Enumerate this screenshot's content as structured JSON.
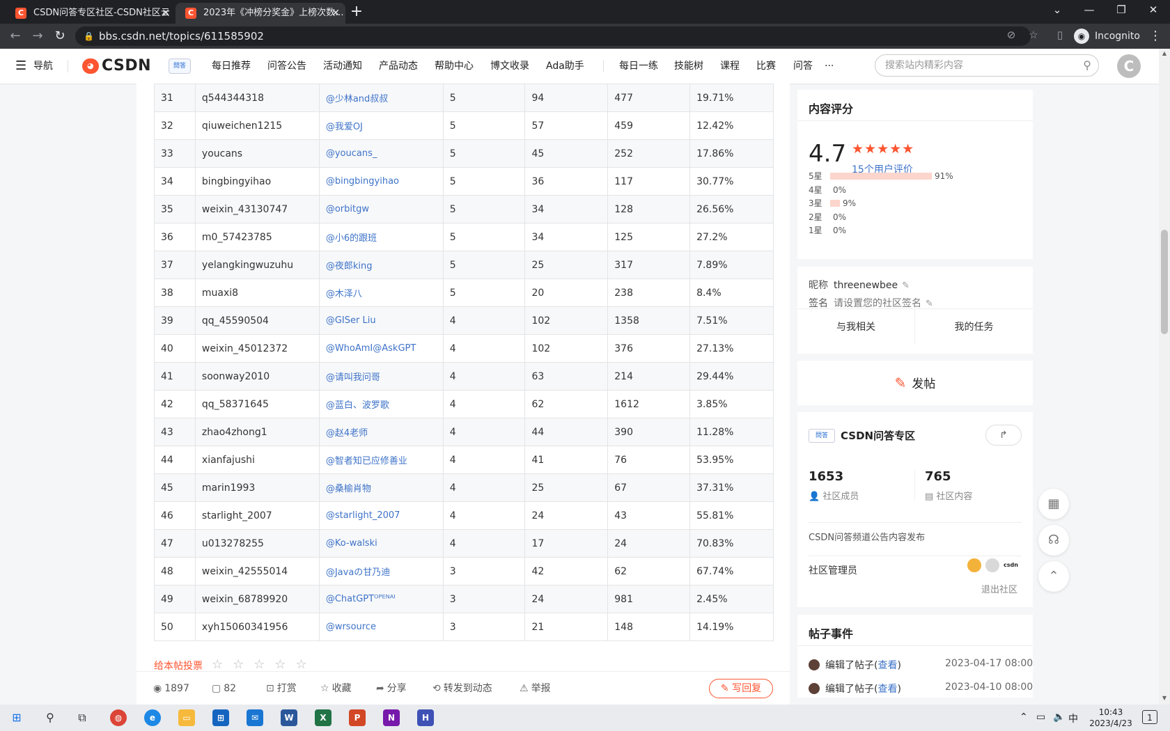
{
  "browser": {
    "tabs": [
      {
        "title": "CSDN问答专区社区-CSDN社区云",
        "active": false
      },
      {
        "title": "2023年《冲榜分奖金》上榜次数...",
        "active": true
      }
    ],
    "url": "bbs.csdn.net/topics/611585902",
    "incognito_label": "Incognito"
  },
  "site": {
    "nav_label": "导航",
    "logo_text": "CSDN",
    "section_badge": "問答",
    "nav_items": [
      "每日推荐",
      "问答公告",
      "活动通知",
      "产品动态",
      "帮助中心",
      "博文收录",
      "Ada助手",
      "每日一练",
      "技能树",
      "课程",
      "比赛",
      "问答",
      "···"
    ],
    "search_placeholder": "搜索站内精彩内容"
  },
  "table": {
    "rows": [
      [
        "31",
        "q544344318",
        "@少林and叔叔",
        "5",
        "94",
        "477",
        "19.71%"
      ],
      [
        "32",
        "qiuweichen1215",
        "@我爱OJ",
        "5",
        "57",
        "459",
        "12.42%"
      ],
      [
        "33",
        "youcans",
        "@youcans_",
        "5",
        "45",
        "252",
        "17.86%"
      ],
      [
        "34",
        "bingbingyihao",
        "@bingbingyihao",
        "5",
        "36",
        "117",
        "30.77%"
      ],
      [
        "35",
        "weixin_43130747",
        "@orbitgw",
        "5",
        "34",
        "128",
        "26.56%"
      ],
      [
        "36",
        "m0_57423785",
        "@小6的跟班",
        "5",
        "34",
        "125",
        "27.2%"
      ],
      [
        "37",
        "yelangkingwuzuhu",
        "@夜郎king",
        "5",
        "25",
        "317",
        "7.89%"
      ],
      [
        "38",
        "muaxi8",
        "@木泽八",
        "5",
        "20",
        "238",
        "8.4%"
      ],
      [
        "39",
        "qq_45590504",
        "@GISer Liu",
        "4",
        "102",
        "1358",
        "7.51%"
      ],
      [
        "40",
        "weixin_45012372",
        "@WhoAmI@AskGPT",
        "4",
        "102",
        "376",
        "27.13%"
      ],
      [
        "41",
        "soonway2010",
        "@请叫我问哥",
        "4",
        "63",
        "214",
        "29.44%"
      ],
      [
        "42",
        "qq_58371645",
        "@蓝白、波罗歌",
        "4",
        "62",
        "1612",
        "3.85%"
      ],
      [
        "43",
        "zhao4zhong1",
        "@赵4老师",
        "4",
        "44",
        "390",
        "11.28%"
      ],
      [
        "44",
        "xianfajushi",
        "@智者知已应修善业",
        "4",
        "41",
        "76",
        "53.95%"
      ],
      [
        "45",
        "marin1993",
        "@桑榆肖物",
        "4",
        "25",
        "67",
        "37.31%"
      ],
      [
        "46",
        "starlight_2007",
        "@starlight_2007",
        "4",
        "24",
        "43",
        "55.81%"
      ],
      [
        "47",
        "u013278255",
        "@Ko-walski",
        "4",
        "17",
        "24",
        "70.83%"
      ],
      [
        "48",
        "weixin_42555014",
        "@Javaの甘乃迪",
        "3",
        "42",
        "62",
        "67.74%"
      ],
      [
        "49",
        "weixin_68789920",
        "@ChatGPTᴼᴾᴱᴺᴬᴵ",
        "3",
        "24",
        "981",
        "2.45%"
      ],
      [
        "50",
        "xyh15060341956",
        "@wrsource",
        "3",
        "21",
        "148",
        "14.19%"
      ]
    ]
  },
  "rate_post": {
    "label": "给本帖投票",
    "stars": "☆☆☆☆☆"
  },
  "action_bar": {
    "views": "1897",
    "comments": "82",
    "tip": "打赏",
    "favorite": "收藏",
    "share": "分享",
    "forward": "转发到动态",
    "report": "举报",
    "reply": "写回复"
  },
  "content_rating": {
    "title": "内容评分",
    "score": "4.7",
    "stars": "★★★★★",
    "count_label": "15个用户评价",
    "distribution": [
      {
        "label": "5星",
        "pct": "91%",
        "fraction": 0.91
      },
      {
        "label": "4星",
        "pct": "0%",
        "fraction": 0
      },
      {
        "label": "3星",
        "pct": "9%",
        "fraction": 0.09
      },
      {
        "label": "2星",
        "pct": "0%",
        "fraction": 0
      },
      {
        "label": "1星",
        "pct": "0%",
        "fraction": 0
      }
    ]
  },
  "profile": {
    "nickname_label": "昵称",
    "nickname": "threenewbee",
    "signature_label": "签名",
    "signature_placeholder": "请设置您的社区签名",
    "tab_related": "与我相关",
    "tab_tasks": "我的任务"
  },
  "post_button": {
    "label": "发帖"
  },
  "community": {
    "badge": "問答",
    "name": "CSDN问答专区",
    "members_count": "1653",
    "members_label": "社区成员",
    "content_count": "765",
    "content_label": "社区内容",
    "description": "CSDN问答频道公告内容发布",
    "admin_label": "社区管理员",
    "admin_third": "csdn",
    "leave_label": "退出社区"
  },
  "events": {
    "title": "帖子事件",
    "items": [
      {
        "text": "编辑了帖子(",
        "link": "查看",
        "close": ")",
        "time": "2023-04-17 08:00"
      },
      {
        "text": "编辑了帖子(",
        "link": "查看",
        "close": ")",
        "time": "2023-04-10 08:00"
      }
    ]
  },
  "taskbar": {
    "ime": "中",
    "time": "10:43",
    "date": "2023/4/23",
    "notifications": "1"
  },
  "colors": {
    "accent": "#fc5531",
    "link": "#3e73c8",
    "bar": "#fcd5cc"
  }
}
